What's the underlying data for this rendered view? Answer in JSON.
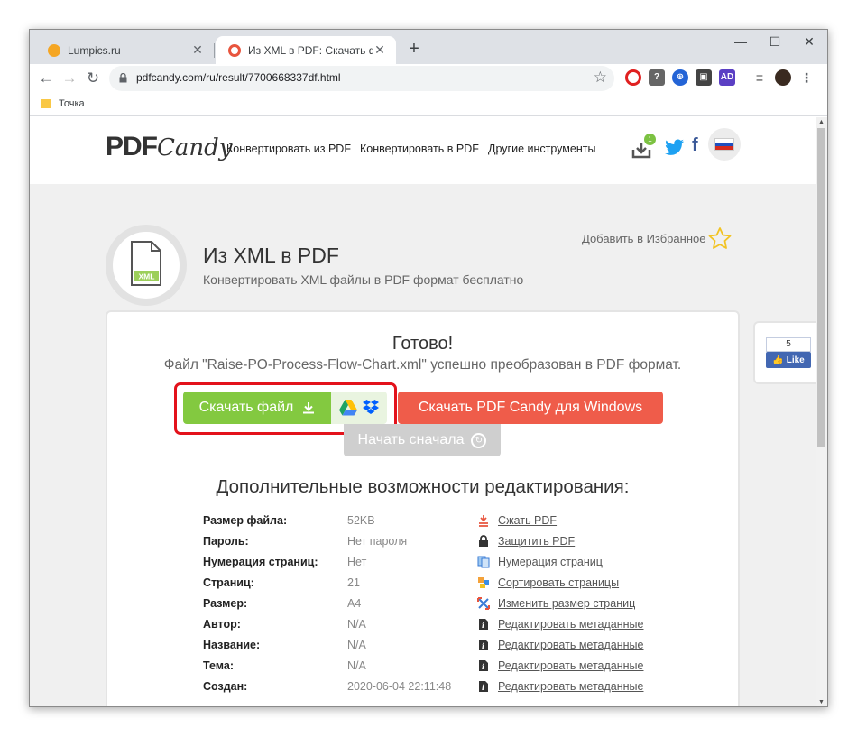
{
  "browser": {
    "tabs": [
      {
        "title": "Lumpics.ru",
        "favicon_color": "#f5a623"
      },
      {
        "title": "Из XML в PDF: Скачать файл(ы)",
        "favicon_color": "#e8553e"
      }
    ],
    "new_tab_label": "+",
    "url": "pdfcandy.com/ru/result/7700668337df.html",
    "bookmarks": [
      {
        "label": "Точка"
      }
    ]
  },
  "site": {
    "logo_pdf": "PDF",
    "logo_candy": "Candy",
    "nav": [
      "Конвертировать из PDF",
      "Конвертировать в PDF",
      "Другие инструменты"
    ],
    "download_badge": "1"
  },
  "page": {
    "file_icon_label": "XML",
    "title": "Из XML в PDF",
    "subtitle": "Конвертировать XML файлы в PDF формат бесплатно",
    "add_favorite": "Добавить в Избранное"
  },
  "result": {
    "ready": "Готово!",
    "message": "Файл \"Raise-PO-Process-Flow-Chart.xml\" успешно преобразован в PDF формат.",
    "download_label": "Скачать файл",
    "windows_label": "Скачать PDF Candy для Windows",
    "restart_label": "Начать сначала",
    "more_title": "Дополнительные возможности редактирования:"
  },
  "properties": [
    {
      "key": "Размер файла:",
      "value": "52KB",
      "action": "Сжать PDF",
      "icon": "compress-icon"
    },
    {
      "key": "Пароль:",
      "value": "Нет пароля",
      "action": "Защитить PDF",
      "icon": "lock-icon"
    },
    {
      "key": "Нумерация страниц:",
      "value": "Нет",
      "action": "Нумерация страниц",
      "icon": "page-numbers-icon"
    },
    {
      "key": "Страниц:",
      "value": "21",
      "action": "Сортировать страницы",
      "icon": "sort-pages-icon"
    },
    {
      "key": "Размер:",
      "value": "A4",
      "action": "Изменить размер страниц",
      "icon": "resize-icon"
    },
    {
      "key": "Автор:",
      "value": "N/A",
      "action": "Редактировать метаданные",
      "icon": "info-doc-icon"
    },
    {
      "key": "Название:",
      "value": "N/A",
      "action": "Редактировать метаданные",
      "icon": "info-doc-icon"
    },
    {
      "key": "Тема:",
      "value": "N/A",
      "action": "Редактировать метаданные",
      "icon": "info-doc-icon"
    },
    {
      "key": "Создан:",
      "value": "2020-06-04 22:11:48",
      "action": "Редактировать метаданные",
      "icon": "info-doc-icon"
    }
  ],
  "facebook": {
    "count": "5",
    "label": "Like"
  },
  "colors": {
    "download_green": "#83c940",
    "windows_red": "#ef5c4a",
    "highlight_red": "#e3121b",
    "restart_gray": "#cfcfcf"
  }
}
